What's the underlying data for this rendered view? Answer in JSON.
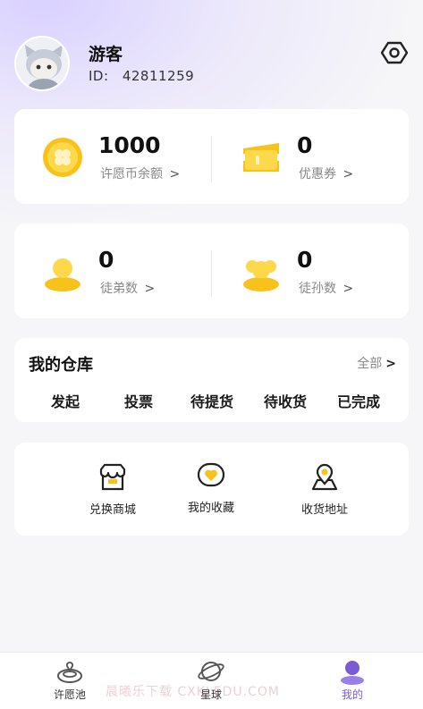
{
  "profile": {
    "username": "游客",
    "id_label": "ID:",
    "id_value": "42811259"
  },
  "stats": {
    "balance_value": "1000",
    "balance_label": "许愿币余额",
    "coupons_value": "0",
    "coupons_label": "优惠券",
    "disciples_value": "0",
    "disciples_label": "徒弟数",
    "grand_disciples_value": "0",
    "grand_disciples_label": "徒孙数",
    "chevron": ">"
  },
  "warehouse": {
    "title": "我的仓库",
    "all_label": "全部",
    "all_chevron": ">",
    "tabs": [
      "发起",
      "投票",
      "待提货",
      "待收货",
      "已完成"
    ]
  },
  "shortcuts": [
    {
      "label": "兑换商城",
      "icon": "shop-icon"
    },
    {
      "label": "我的收藏",
      "icon": "heart-icon"
    },
    {
      "label": "收货地址",
      "icon": "location-icon"
    }
  ],
  "tabbar": {
    "items": [
      {
        "label": "许愿池",
        "icon": "wish-pool-icon",
        "active": false
      },
      {
        "label": "星球",
        "icon": "planet-icon",
        "active": false
      },
      {
        "label": "我的",
        "icon": "profile-icon",
        "active": true
      }
    ]
  },
  "watermark": "晨曦乐下载 CXKLEDU.COM",
  "colors": {
    "accent": "#7b5ad6",
    "gold": "#f7c21a",
    "background": "#f6f6f8"
  }
}
